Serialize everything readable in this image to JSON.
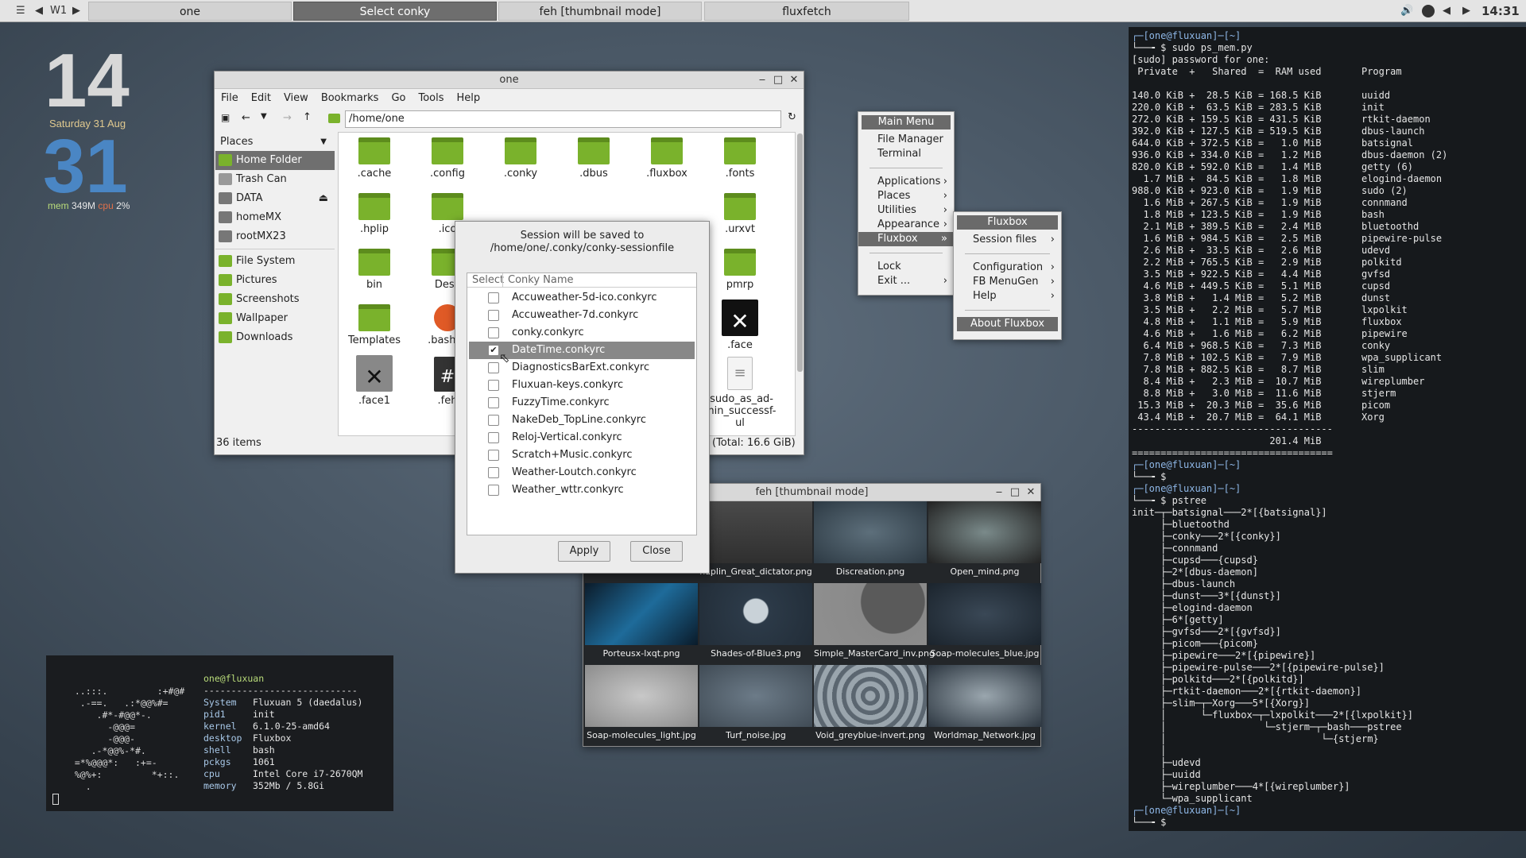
{
  "taskbar": {
    "workspace": "W1",
    "tasks": [
      "one",
      "Select conky",
      "feh [thumbnail mode]",
      "fluxfetch"
    ],
    "clock": "14:31"
  },
  "conky": {
    "hour": "14",
    "date": "Saturday 31 Aug",
    "minute": "31",
    "mem_label": "mem",
    "mem_value": "349M",
    "cpu_label": "cpu",
    "cpu_value": "2%"
  },
  "filemanager": {
    "title": "one",
    "menu": [
      "File",
      "Edit",
      "View",
      "Bookmarks",
      "Go",
      "Tools",
      "Help"
    ],
    "path": "/home/one",
    "places_label": "Places",
    "places": [
      "Home Folder",
      "Trash Can",
      "DATA",
      "homeMX",
      "rootMX23"
    ],
    "folders": [
      "File System",
      "Pictures",
      "Screenshots",
      "Wallpaper",
      "Downloads"
    ],
    "items": [
      ".cache",
      ".config",
      ".conky",
      ".dbus",
      ".fluxbox",
      ".fonts",
      ".hplip",
      ".ico",
      ".urxvt",
      "bin",
      "Desk",
      "pmrp",
      "Templates",
      ".bash_a",
      ".face",
      ".face1",
      ".feh",
      ".sudo_as_ad-\nmin_successf-\nul"
    ],
    "status_left": "36 items",
    "status_right": "(Total: 16.6 GiB)"
  },
  "dialog": {
    "message_line1": "Session will be saved to",
    "message_line2": "/home/one/.conky/conky-sessionfile",
    "col_select": "Select",
    "col_name": "Conky Name",
    "rows": [
      "Accuweather-5d-ico.conkyrc",
      "Accuweather-7d.conkyrc",
      "conky.conkyrc",
      "DateTime.conkyrc",
      "DiagnosticsBarExt.conkyrc",
      "Fluxuan-keys.conkyrc",
      "FuzzyTime.conkyrc",
      "NakeDeb_TopLine.conkyrc",
      "Reloj-Vertical.conkyrc",
      "Scratch+Music.conkyrc",
      "Weather-Loutch.conkyrc",
      "Weather_wttr.conkyrc"
    ],
    "checked": "DateTime.conkyrc",
    "apply": "Apply",
    "close": "Close"
  },
  "main_menu": {
    "title": "Main Menu",
    "items": [
      "File Manager",
      "Terminal",
      "Applications",
      "Places",
      "Utilities",
      "Appearance",
      "Fluxbox",
      "Lock",
      "Exit ..."
    ]
  },
  "fluxbox_menu": {
    "title": "Fluxbox",
    "items": [
      "Session files",
      "Configuration",
      "FB MenuGen",
      "Help",
      "About Fluxbox"
    ]
  },
  "feh": {
    "title": "feh [thumbnail mode]",
    "thumbs": [
      "",
      "haplin_Great_dictator.png",
      "Discreation.png",
      "Open_mind.png",
      "Porteusx-lxqt.png",
      "Shades-of-Blue3.png",
      "Simple_MasterCard_inv.png",
      "Soap-molecules_blue.jpg",
      "Soap-molecules_light.jpg",
      "Turf_noise.jpg",
      "Void_greyblue-invert.png",
      "Worldmap_Network.jpg"
    ]
  },
  "fetch": {
    "user": "one@fluxuan",
    "sep": "----------------------------",
    "art": [
      "  ..:::.         :+#@#",
      "   .-==.   .:*@@%#=  ",
      "      .#*-#@@*-.     ",
      "        -@@@=        ",
      "        -@@@-        ",
      "     .-*@@%-*#.      ",
      "  =*%@@@*:   :+=-    ",
      "  %@%+:         *+::.",
      "    .                "
    ],
    "keys": [
      "System",
      "pid1",
      "kernel",
      "desktop",
      "shell",
      "pckgs",
      "cpu",
      "memory"
    ],
    "values": [
      "Fluxuan 5 (daedalus)",
      "init",
      "6.1.0-25-amd64",
      "Fluxbox",
      "bash",
      "1061",
      "Intel Core i7-2670QM",
      "352Mb / 5.8Gi"
    ]
  },
  "terminal": {
    "lines": [
      "┌─[one@fluxuan]─[~]",
      "└──╼ $ sudo ps_mem.py",
      "[sudo] password for one:",
      " Private  +   Shared  =  RAM used       Program",
      "",
      "140.0 KiB +  28.5 KiB = 168.5 KiB       uuidd",
      "220.0 KiB +  63.5 KiB = 283.5 KiB       init",
      "272.0 KiB + 159.5 KiB = 431.5 KiB       rtkit-daemon",
      "392.0 KiB + 127.5 KiB = 519.5 KiB       dbus-launch",
      "644.0 KiB + 372.5 KiB =   1.0 MiB       batsignal",
      "936.0 KiB + 334.0 KiB =   1.2 MiB       dbus-daemon (2)",
      "820.0 KiB + 592.0 KiB =   1.4 MiB       getty (6)",
      "  1.7 MiB +  84.5 KiB =   1.8 MiB       elogind-daemon",
      "988.0 KiB + 923.0 KiB =   1.9 MiB       sudo (2)",
      "  1.6 MiB + 267.5 KiB =   1.9 MiB       connmand",
      "  1.8 MiB + 123.5 KiB =   1.9 MiB       bash",
      "  2.1 MiB + 389.5 KiB =   2.4 MiB       bluetoothd",
      "  1.6 MiB + 984.5 KiB =   2.5 MiB       pipewire-pulse",
      "  2.6 MiB +  33.5 KiB =   2.6 MiB       udevd",
      "  2.2 MiB + 765.5 KiB =   2.9 MiB       polkitd",
      "  3.5 MiB + 922.5 KiB =   4.4 MiB       gvfsd",
      "  4.6 MiB + 449.5 KiB =   5.1 MiB       cupsd",
      "  3.8 MiB +   1.4 MiB =   5.2 MiB       dunst",
      "  3.5 MiB +   2.2 MiB =   5.7 MiB       lxpolkit",
      "  4.8 MiB +   1.1 MiB =   5.9 MiB       fluxbox",
      "  4.6 MiB +   1.6 MiB =   6.2 MiB       pipewire",
      "  6.4 MiB + 968.5 KiB =   7.3 MiB       conky",
      "  7.8 MiB + 102.5 KiB =   7.9 MiB       wpa_supplicant",
      "  7.8 MiB + 882.5 KiB =   8.7 MiB       slim",
      "  8.4 MiB +   2.3 MiB =  10.7 MiB       wireplumber",
      "  8.8 MiB +   3.0 MiB =  11.6 MiB       stjerm",
      " 15.3 MiB +  20.3 MiB =  35.6 MiB       picom",
      " 43.4 MiB +  20.7 MiB =  64.1 MiB       Xorg",
      "-----------------------------------",
      "                        201.4 MiB",
      "===================================",
      "┌─[one@fluxuan]─[~]",
      "└──╼ $",
      "┌─[one@fluxuan]─[~]",
      "└──╼ $ pstree",
      "init─┬─batsignal───2*[{batsignal}]",
      "     ├─bluetoothd",
      "     ├─conky───2*[{conky}]",
      "     ├─connmand",
      "     ├─cupsd───{cupsd}",
      "     ├─2*[dbus-daemon]",
      "     ├─dbus-launch",
      "     ├─dunst───3*[{dunst}]",
      "     ├─elogind-daemon",
      "     ├─6*[getty]",
      "     ├─gvfsd───2*[{gvfsd}]",
      "     ├─picom───{picom}",
      "     ├─pipewire───2*[{pipewire}]",
      "     ├─pipewire-pulse───2*[{pipewire-pulse}]",
      "     ├─polkitd───2*[{polkitd}]",
      "     ├─rtkit-daemon───2*[{rtkit-daemon}]",
      "     ├─slim─┬─Xorg───5*[{Xorg}]",
      "     │      └─fluxbox─┬─lxpolkit───2*[{lxpolkit}]",
      "     │                 └─stjerm─┬─bash───pstree",
      "     │                           └─{stjerm}",
      "     │",
      "     ├─udevd",
      "     ├─uuidd",
      "     ├─wireplumber───4*[{wireplumber}]",
      "     └─wpa_supplicant",
      "┌─[one@fluxuan]─[~]",
      "└──╼ $"
    ]
  }
}
